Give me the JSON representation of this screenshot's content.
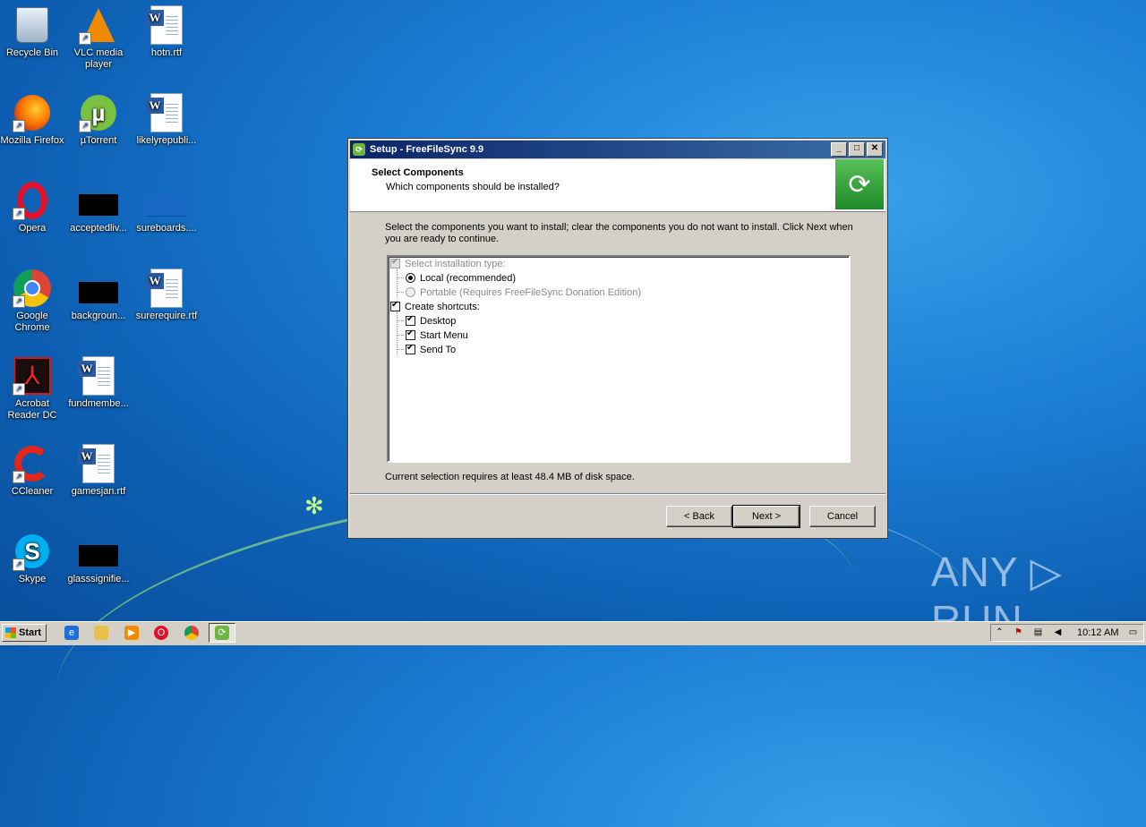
{
  "desktop": {
    "icons": [
      {
        "label": "Recycle Bin",
        "icon": "recycle-bin-icon"
      },
      {
        "label": "VLC media player",
        "icon": "vlc-icon"
      },
      {
        "label": "hotn.rtf",
        "icon": "word-document-icon"
      },
      {
        "label": "Mozilla Firefox",
        "icon": "firefox-icon"
      },
      {
        "label": "µTorrent",
        "icon": "utorrent-icon"
      },
      {
        "label": "likelyrepubli...",
        "icon": "word-document-icon"
      },
      {
        "label": "Opera",
        "icon": "opera-icon"
      },
      {
        "label": "acceptedliv...",
        "icon": "black-thumbnail-icon"
      },
      {
        "label": "sureboards....",
        "icon": "blue-thumbnail-icon"
      },
      {
        "label": "Google Chrome",
        "icon": "chrome-icon"
      },
      {
        "label": "backgroun...",
        "icon": "black-thumbnail-icon"
      },
      {
        "label": "surerequire.rtf",
        "icon": "word-document-icon"
      },
      {
        "label": "Acrobat Reader DC",
        "icon": "acrobat-icon"
      },
      {
        "label": "fundmembe...",
        "icon": "word-document-icon"
      },
      {
        "label": "CCleaner",
        "icon": "ccleaner-icon"
      },
      {
        "label": "gamesjan.rtf",
        "icon": "word-document-icon"
      },
      {
        "label": "Skype",
        "icon": "skype-icon"
      },
      {
        "label": "glasssignifie...",
        "icon": "black-thumbnail-icon"
      }
    ]
  },
  "dialog": {
    "title": "Setup - FreeFileSync 9.9",
    "header_title": "Select Components",
    "header_subtitle": "Which components should be installed?",
    "intro": "Select the components you want to install; clear the components you do not want to install. Click Next when you are ready to continue.",
    "components": {
      "install_type": "Select installation type:",
      "local": "Local (recommended)",
      "portable": "Portable (Requires FreeFileSync Donation Edition)",
      "shortcuts": "Create shortcuts:",
      "desktop": "Desktop",
      "start_menu": "Start Menu",
      "send_to": "Send To"
    },
    "disk_space": "Current selection requires at least 48.4 MB of disk space.",
    "buttons": {
      "back": "< Back",
      "next": "Next >",
      "cancel": "Cancel"
    }
  },
  "watermark": "ANY ▷ RUN",
  "taskbar": {
    "start_label": "Start",
    "clock": "10:12 AM"
  }
}
